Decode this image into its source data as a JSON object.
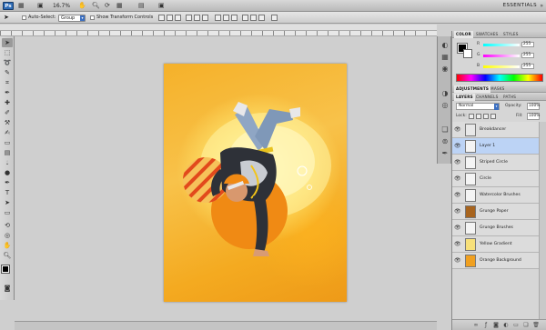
{
  "app": {
    "logo": "Ps",
    "zoom": "16.7%",
    "workspace": "ESSENTIALS"
  },
  "options": {
    "auto_select_label": "Auto-Select:",
    "auto_select_value": "Group",
    "transform_label": "Show Transform Controls"
  },
  "color_panel": {
    "tabs": [
      "COLOR",
      "SWATCHES",
      "STYLES"
    ],
    "channels": [
      {
        "label": "R",
        "value": "255"
      },
      {
        "label": "G",
        "value": "255"
      },
      {
        "label": "B",
        "value": "255"
      }
    ]
  },
  "adjust_panel": {
    "tabs": [
      "ADJUSTMENTS",
      "MASKS"
    ]
  },
  "layers_panel": {
    "tabs": [
      "LAYERS",
      "CHANNELS",
      "PATHS"
    ],
    "blend_mode": "Normal",
    "opacity_label": "Opacity:",
    "opacity_value": "100%",
    "lock_label": "Lock:",
    "fill_label": "Fill:",
    "fill_value": "100%",
    "layers": [
      {
        "name": "Breakdancer",
        "thumb_color": "#e8e8e8",
        "selected": false
      },
      {
        "name": "Layer 1",
        "thumb_color": "#f4f4f4",
        "selected": true
      },
      {
        "name": "Striped Circle",
        "thumb_color": "#f4f4f4",
        "selected": false
      },
      {
        "name": "Circle",
        "thumb_color": "#f4f4f4",
        "selected": false
      },
      {
        "name": "Watercolor Brushes",
        "thumb_color": "#f4f4f4",
        "selected": false
      },
      {
        "name": "Grunge Paper",
        "thumb_color": "#a8641e",
        "selected": false
      },
      {
        "name": "Grunge Brushes",
        "thumb_color": "#f4f4f4",
        "selected": false
      },
      {
        "name": "Yellow Gradient",
        "thumb_color": "#f7e07a",
        "selected": false
      },
      {
        "name": "Orange Background",
        "thumb_color": "#f0a020",
        "selected": false
      }
    ]
  },
  "colors": {
    "accent": "#3b6fc1",
    "selected_layer": "#bcd3f5",
    "canvas_orange": "#f5b12a"
  }
}
